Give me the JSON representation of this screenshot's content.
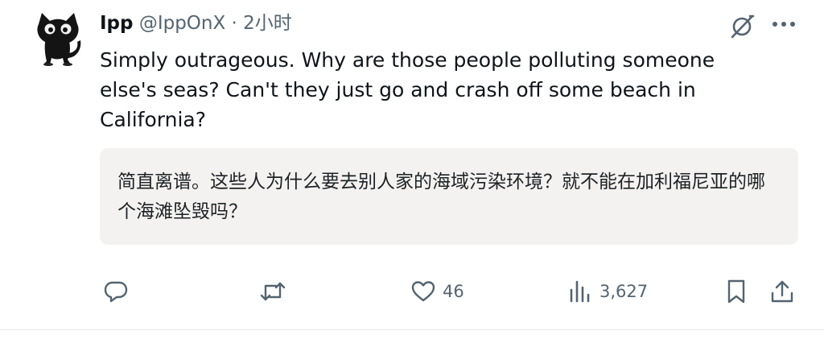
{
  "author": {
    "name": "Ipp",
    "handle": "@IppOnX",
    "separator": "·",
    "time": "2小时",
    "avatar_icon": "black-cat-avatar"
  },
  "tweet": {
    "text": "Simply outrageous. Why are those people polluting someone else's seas? Can't they just go and crash off some beach in California?"
  },
  "translation": {
    "text": "简直离谱。这些人为什么要去别人家的海域污染环境？就不能在加利福尼亚的哪个海滩坠毁吗？"
  },
  "header_icons": [
    "grok-icon",
    "more-icon"
  ],
  "actions": {
    "reply": {
      "icon": "reply-icon",
      "count": ""
    },
    "repost": {
      "icon": "repost-icon",
      "count": ""
    },
    "like": {
      "icon": "heart-icon",
      "count": "46"
    },
    "views": {
      "icon": "views-icon",
      "count": "3,627"
    },
    "bookmark": {
      "icon": "bookmark-icon"
    },
    "share": {
      "icon": "share-icon"
    }
  },
  "colors": {
    "text": "#0f1419",
    "secondary": "#536471",
    "translation_bg": "#f4f2f0"
  }
}
